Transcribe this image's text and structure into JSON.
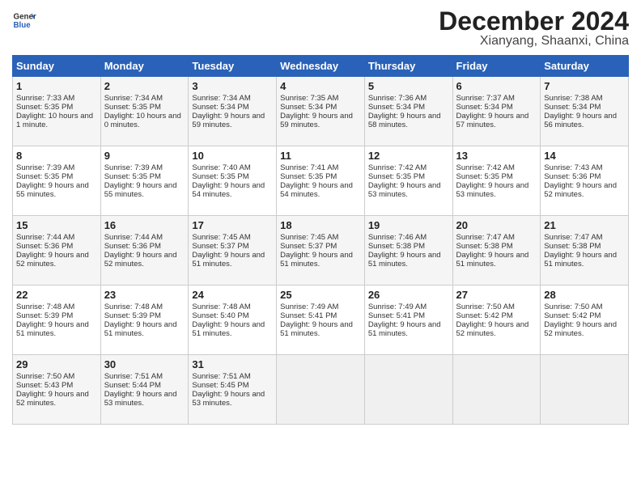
{
  "header": {
    "logo_line1": "General",
    "logo_line2": "Blue",
    "month": "December 2024",
    "location": "Xianyang, Shaanxi, China"
  },
  "days_of_week": [
    "Sunday",
    "Monday",
    "Tuesday",
    "Wednesday",
    "Thursday",
    "Friday",
    "Saturday"
  ],
  "weeks": [
    [
      {
        "day": "1",
        "sunrise": "Sunrise: 7:33 AM",
        "sunset": "Sunset: 5:35 PM",
        "daylight": "Daylight: 10 hours and 1 minute."
      },
      {
        "day": "2",
        "sunrise": "Sunrise: 7:34 AM",
        "sunset": "Sunset: 5:35 PM",
        "daylight": "Daylight: 10 hours and 0 minutes."
      },
      {
        "day": "3",
        "sunrise": "Sunrise: 7:34 AM",
        "sunset": "Sunset: 5:34 PM",
        "daylight": "Daylight: 9 hours and 59 minutes."
      },
      {
        "day": "4",
        "sunrise": "Sunrise: 7:35 AM",
        "sunset": "Sunset: 5:34 PM",
        "daylight": "Daylight: 9 hours and 59 minutes."
      },
      {
        "day": "5",
        "sunrise": "Sunrise: 7:36 AM",
        "sunset": "Sunset: 5:34 PM",
        "daylight": "Daylight: 9 hours and 58 minutes."
      },
      {
        "day": "6",
        "sunrise": "Sunrise: 7:37 AM",
        "sunset": "Sunset: 5:34 PM",
        "daylight": "Daylight: 9 hours and 57 minutes."
      },
      {
        "day": "7",
        "sunrise": "Sunrise: 7:38 AM",
        "sunset": "Sunset: 5:34 PM",
        "daylight": "Daylight: 9 hours and 56 minutes."
      }
    ],
    [
      {
        "day": "8",
        "sunrise": "Sunrise: 7:39 AM",
        "sunset": "Sunset: 5:35 PM",
        "daylight": "Daylight: 9 hours and 55 minutes."
      },
      {
        "day": "9",
        "sunrise": "Sunrise: 7:39 AM",
        "sunset": "Sunset: 5:35 PM",
        "daylight": "Daylight: 9 hours and 55 minutes."
      },
      {
        "day": "10",
        "sunrise": "Sunrise: 7:40 AM",
        "sunset": "Sunset: 5:35 PM",
        "daylight": "Daylight: 9 hours and 54 minutes."
      },
      {
        "day": "11",
        "sunrise": "Sunrise: 7:41 AM",
        "sunset": "Sunset: 5:35 PM",
        "daylight": "Daylight: 9 hours and 54 minutes."
      },
      {
        "day": "12",
        "sunrise": "Sunrise: 7:42 AM",
        "sunset": "Sunset: 5:35 PM",
        "daylight": "Daylight: 9 hours and 53 minutes."
      },
      {
        "day": "13",
        "sunrise": "Sunrise: 7:42 AM",
        "sunset": "Sunset: 5:35 PM",
        "daylight": "Daylight: 9 hours and 53 minutes."
      },
      {
        "day": "14",
        "sunrise": "Sunrise: 7:43 AM",
        "sunset": "Sunset: 5:36 PM",
        "daylight": "Daylight: 9 hours and 52 minutes."
      }
    ],
    [
      {
        "day": "15",
        "sunrise": "Sunrise: 7:44 AM",
        "sunset": "Sunset: 5:36 PM",
        "daylight": "Daylight: 9 hours and 52 minutes."
      },
      {
        "day": "16",
        "sunrise": "Sunrise: 7:44 AM",
        "sunset": "Sunset: 5:36 PM",
        "daylight": "Daylight: 9 hours and 52 minutes."
      },
      {
        "day": "17",
        "sunrise": "Sunrise: 7:45 AM",
        "sunset": "Sunset: 5:37 PM",
        "daylight": "Daylight: 9 hours and 51 minutes."
      },
      {
        "day": "18",
        "sunrise": "Sunrise: 7:45 AM",
        "sunset": "Sunset: 5:37 PM",
        "daylight": "Daylight: 9 hours and 51 minutes."
      },
      {
        "day": "19",
        "sunrise": "Sunrise: 7:46 AM",
        "sunset": "Sunset: 5:38 PM",
        "daylight": "Daylight: 9 hours and 51 minutes."
      },
      {
        "day": "20",
        "sunrise": "Sunrise: 7:47 AM",
        "sunset": "Sunset: 5:38 PM",
        "daylight": "Daylight: 9 hours and 51 minutes."
      },
      {
        "day": "21",
        "sunrise": "Sunrise: 7:47 AM",
        "sunset": "Sunset: 5:38 PM",
        "daylight": "Daylight: 9 hours and 51 minutes."
      }
    ],
    [
      {
        "day": "22",
        "sunrise": "Sunrise: 7:48 AM",
        "sunset": "Sunset: 5:39 PM",
        "daylight": "Daylight: 9 hours and 51 minutes."
      },
      {
        "day": "23",
        "sunrise": "Sunrise: 7:48 AM",
        "sunset": "Sunset: 5:39 PM",
        "daylight": "Daylight: 9 hours and 51 minutes."
      },
      {
        "day": "24",
        "sunrise": "Sunrise: 7:48 AM",
        "sunset": "Sunset: 5:40 PM",
        "daylight": "Daylight: 9 hours and 51 minutes."
      },
      {
        "day": "25",
        "sunrise": "Sunrise: 7:49 AM",
        "sunset": "Sunset: 5:41 PM",
        "daylight": "Daylight: 9 hours and 51 minutes."
      },
      {
        "day": "26",
        "sunrise": "Sunrise: 7:49 AM",
        "sunset": "Sunset: 5:41 PM",
        "daylight": "Daylight: 9 hours and 51 minutes."
      },
      {
        "day": "27",
        "sunrise": "Sunrise: 7:50 AM",
        "sunset": "Sunset: 5:42 PM",
        "daylight": "Daylight: 9 hours and 52 minutes."
      },
      {
        "day": "28",
        "sunrise": "Sunrise: 7:50 AM",
        "sunset": "Sunset: 5:42 PM",
        "daylight": "Daylight: 9 hours and 52 minutes."
      }
    ],
    [
      {
        "day": "29",
        "sunrise": "Sunrise: 7:50 AM",
        "sunset": "Sunset: 5:43 PM",
        "daylight": "Daylight: 9 hours and 52 minutes."
      },
      {
        "day": "30",
        "sunrise": "Sunrise: 7:51 AM",
        "sunset": "Sunset: 5:44 PM",
        "daylight": "Daylight: 9 hours and 53 minutes."
      },
      {
        "day": "31",
        "sunrise": "Sunrise: 7:51 AM",
        "sunset": "Sunset: 5:45 PM",
        "daylight": "Daylight: 9 hours and 53 minutes."
      },
      null,
      null,
      null,
      null
    ]
  ]
}
